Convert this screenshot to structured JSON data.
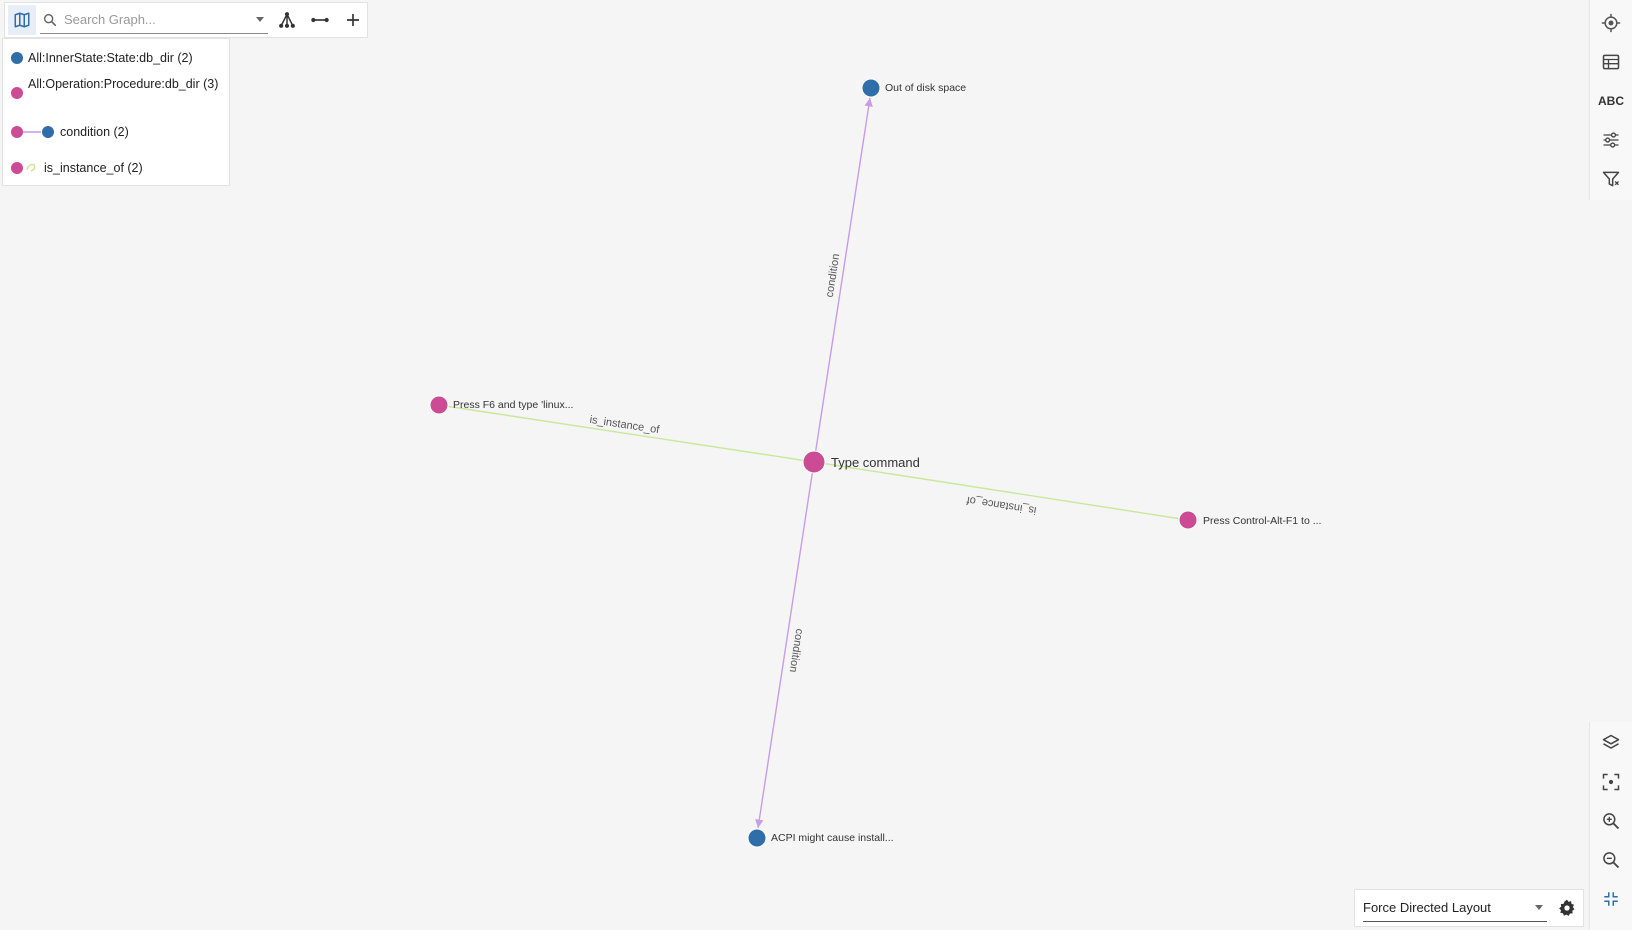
{
  "toolbar": {
    "map_icon": "map-icon",
    "search_placeholder": "Search Graph...",
    "search_value": "",
    "tools": [
      "hierarchy-icon",
      "connect-icon",
      "add-icon"
    ]
  },
  "legend": {
    "items": [
      {
        "label": "All:InnerState:State:db_dir (2)",
        "kind": "node",
        "color": "#2f6ea8"
      },
      {
        "label": "All:Operation:Procedure:db_dir (3)",
        "kind": "node",
        "color": "#cc4b95"
      },
      {
        "label": "condition (2)",
        "kind": "edge",
        "from_color": "#cc4b95",
        "to_color": "#2f6ea8",
        "edge_color": "#c79ce8"
      },
      {
        "label": "is_instance_of (2)",
        "kind": "self-edge",
        "color": "#cc4b95",
        "edge_color": "#c9e89a"
      }
    ]
  },
  "graph": {
    "nodes": [
      {
        "id": "type-command",
        "label": "Type command",
        "color": "#cc4b95"
      },
      {
        "id": "out-of-disk",
        "label": "Out of disk space",
        "color": "#2f6ea8"
      },
      {
        "id": "press-f6",
        "label": "Press F6 and type 'linux...",
        "color": "#cc4b95"
      },
      {
        "id": "press-ctrl",
        "label": "Press Control-Alt-F1 to ...",
        "color": "#cc4b95"
      },
      {
        "id": "acpi",
        "label": "ACPI might cause install...",
        "color": "#2f6ea8"
      }
    ],
    "edges": [
      {
        "from": "type-command",
        "to": "out-of-disk",
        "label": "condition",
        "color": "#c79ce8"
      },
      {
        "from": "type-command",
        "to": "acpi",
        "label": "condition",
        "color": "#c79ce8"
      },
      {
        "from": "press-f6",
        "to": "type-command",
        "label": "is_instance_of",
        "color": "#c9e89a"
      },
      {
        "from": "press-ctrl",
        "to": "type-command",
        "label": "is_instance_of",
        "color": "#c9e89a"
      }
    ]
  },
  "right_rail": {
    "top": [
      "target-icon",
      "table-icon",
      "abc-icon",
      "sliders-icon",
      "filter-icon"
    ],
    "abc_label": "ABC",
    "bottom": [
      "layers-icon",
      "fit-screen-icon",
      "zoom-in-icon",
      "zoom-out-icon",
      "collapse-icon"
    ]
  },
  "layout": {
    "selected": "Force Directed Layout",
    "settings_icon": "gear-icon"
  }
}
